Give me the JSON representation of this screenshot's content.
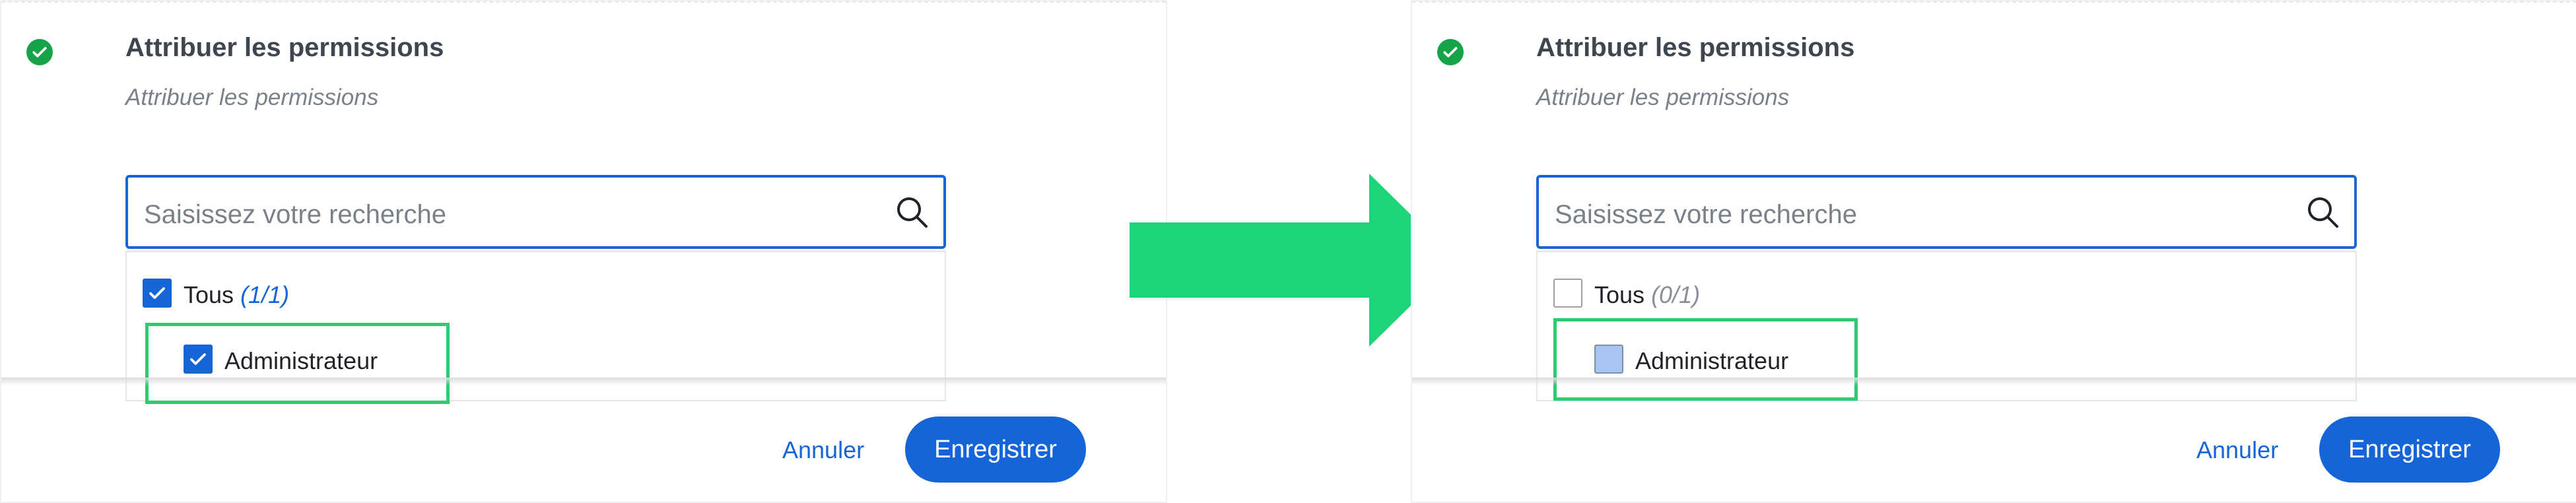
{
  "colors": {
    "primary": "#1565d8",
    "success": "#16a34a",
    "highlight": "#2ecc71",
    "arrow": "#1ed47a"
  },
  "before": {
    "title": "Attribuer les permissions",
    "subtitle": "Attribuer les permissions",
    "search": {
      "placeholder": "Saisissez votre recherche"
    },
    "all_option": {
      "label": "Tous",
      "count": "(1/1)",
      "checked": true
    },
    "items": [
      {
        "label": "Administrateur",
        "state": "checked"
      }
    ],
    "cancel_label": "Annuler",
    "save_label": "Enregistrer"
  },
  "after": {
    "title": "Attribuer les permissions",
    "subtitle": "Attribuer les permissions",
    "search": {
      "placeholder": "Saisissez votre recherche"
    },
    "all_option": {
      "label": "Tous",
      "count": "(0/1)",
      "checked": false
    },
    "items": [
      {
        "label": "Administrateur",
        "state": "partial"
      }
    ],
    "cancel_label": "Annuler",
    "save_label": "Enregistrer"
  },
  "transition_icon": "right-arrow-icon"
}
